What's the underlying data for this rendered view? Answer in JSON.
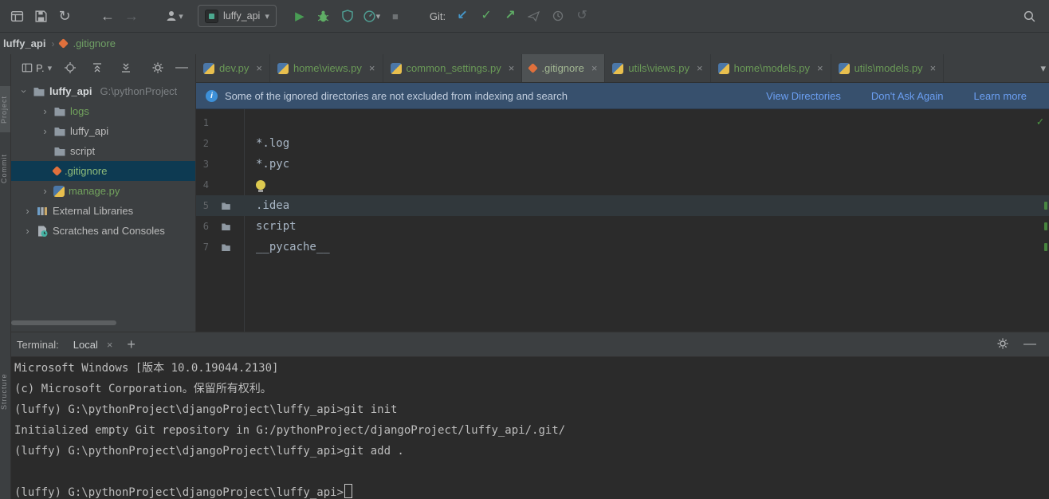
{
  "toolbar": {
    "run_config": "luffy_api",
    "git_label": "Git:"
  },
  "breadcrumbs": {
    "project": "luffy_api",
    "separator": "›",
    "file": ".gitignore"
  },
  "tool_windows": {
    "top": [
      "Project",
      "Commit"
    ],
    "bottom": [
      "Structure"
    ]
  },
  "project_panel": {
    "mode_label": "P.",
    "root_name": "luffy_api",
    "root_path": "G:\\pythonProject",
    "items": [
      {
        "label": "logs"
      },
      {
        "label": "luffy_api"
      },
      {
        "label": "script"
      },
      {
        "label": ".gitignore"
      },
      {
        "label": "manage.py"
      },
      {
        "label": "External Libraries"
      },
      {
        "label": "Scratches and Consoles"
      }
    ]
  },
  "tabs": [
    {
      "label": "dev.py"
    },
    {
      "label": "home\\views.py"
    },
    {
      "label": "common_settings.py"
    },
    {
      "label": ".gitignore"
    },
    {
      "label": "utils\\views.py"
    },
    {
      "label": "home\\models.py"
    },
    {
      "label": "utils\\models.py"
    }
  ],
  "banner": {
    "message": "Some of the ignored directories are not excluded from indexing and search",
    "actions": [
      {
        "label": "View Directories"
      },
      {
        "label": "Don't Ask Again"
      },
      {
        "label": "Learn more"
      }
    ]
  },
  "editor": {
    "lines": [
      {
        "num": "1",
        "text": ""
      },
      {
        "num": "2",
        "text": "*.log"
      },
      {
        "num": "3",
        "text": "*.pyc"
      },
      {
        "num": "4",
        "text": ""
      },
      {
        "num": "5",
        "text": ".idea"
      },
      {
        "num": "6",
        "text": "script"
      },
      {
        "num": "7",
        "text": "__pycache__"
      }
    ]
  },
  "terminal": {
    "label": "Terminal:",
    "tab_label": "Local",
    "lines": [
      "Microsoft Windows [版本 10.0.19044.2130]",
      "(c) Microsoft Corporation。保留所有权利。",
      "(luffy) G:\\pythonProject\\djangoProject\\luffy_api>git init",
      "Initialized empty Git repository in G:/pythonProject/djangoProject/luffy_api/.git/",
      "(luffy) G:\\pythonProject\\djangoProject\\luffy_api>git add .",
      "",
      "(luffy) G:\\pythonProject\\djangoProject\\luffy_api>"
    ]
  },
  "icons": {
    "sync": "↻",
    "back": "←",
    "forward": "→",
    "run": "▶",
    "stop": "■",
    "git_update": "↙",
    "git_commit": "✓",
    "git_push": "↗",
    "git_rollback": "↺",
    "minimize": "—",
    "close": "×",
    "plus": "+",
    "chevron_down": "▾",
    "chevron_right": "›",
    "check": "✓",
    "info": "i"
  },
  "colors": {
    "panel_bg": "#3c3f41",
    "editor_bg": "#2b2b2b",
    "git_added_green": "#6a9a57",
    "tree_selection_bg": "#0d3a52",
    "banner_bg": "#37506d",
    "link_blue": "#6b9ff2",
    "run_green": "#499c54",
    "update_blue": "#4596c7",
    "caret_line": "#31383c"
  }
}
